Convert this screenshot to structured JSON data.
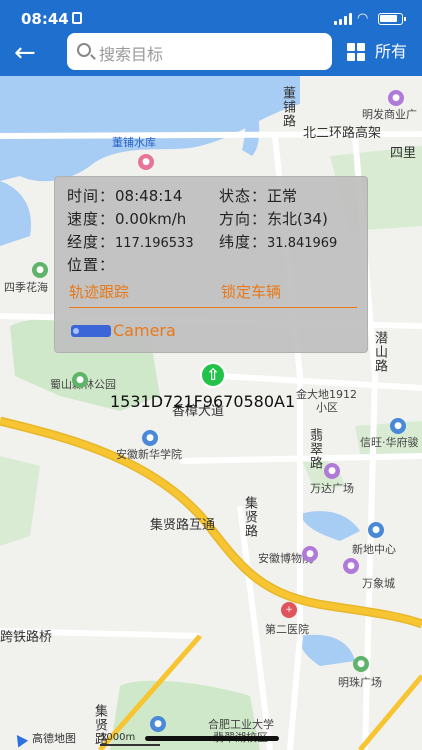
{
  "status_bar": {
    "time": "08:44"
  },
  "header": {
    "back_label": "←",
    "search_placeholder": "搜索目标",
    "all_label": "所有"
  },
  "map": {
    "labels": {
      "dongpu_reservoir": "董铺水库",
      "dongpu_road": "董铺路",
      "mingfa_plaza": "明发商业广",
      "beier_ring_highspeed": "北二环路高架",
      "si_li": "四里",
      "siji_garden": "四季花海",
      "qianshan_road": "潜山路",
      "shushan_forest_park": "蜀山森林公园",
      "jinda_di": "金大地1912",
      "xiao_qu": "小区",
      "xiangzhang_avenue": "香樟大道",
      "anhui_xinhua_college": "安徽新华学院",
      "cuiwei_road": "翡翠路",
      "xinxin_huafu": "信旺·华府骏",
      "wanda_plaza": "万达广场",
      "jixian_interchange": "集贤路互通",
      "jixian_road": "集贤路",
      "anhui_museum": "安徽博物院",
      "xindi_center": "新地中心",
      "wanxiang_city": "万象城",
      "railway_road": "跨铁路桥",
      "second_hospital": "第二医院",
      "mingzhu_plaza": "明珠广场",
      "hfut": "合肥工业大学",
      "cuihu_campus": "翡翠湖校区",
      "jixian_road_2": "集贤路"
    },
    "amap_logo": "高德地图",
    "scale_text": "1000m"
  },
  "vehicle": {
    "plate": "1531D721F9670580A1",
    "marker_glyph": "⇧"
  },
  "popup": {
    "time_label": "时间：",
    "time_value": "08:48:14",
    "state_label": "状态：",
    "state_value": "正常",
    "speed_label": "速度：",
    "speed_value": "0.00km/h",
    "direction_label": "方向：",
    "direction_value": "东北(34)",
    "lng_label": "经度：",
    "lng_value": "117.196533",
    "lat_label": "纬度：",
    "lat_value": "31.841969",
    "position_label": "位置：",
    "track_link": "轨迹跟踪",
    "lock_link": "锁定车辆",
    "camera_label": "Camera"
  },
  "colors": {
    "header_bg": "#1f6fcf",
    "accent_orange": "#e97918",
    "water": "#a8cdf5",
    "park_green": "#cfe8c9",
    "highway_yellow": "#f7c531"
  }
}
